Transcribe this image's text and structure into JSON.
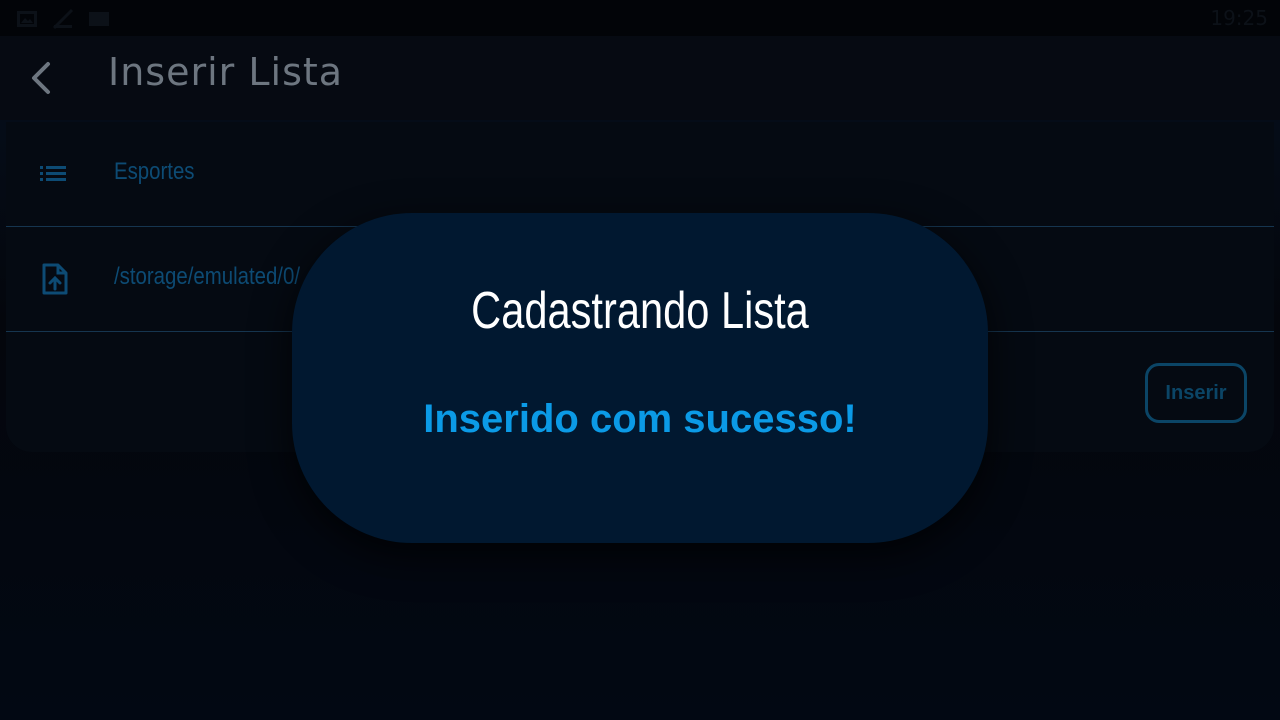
{
  "status_bar": {
    "time": "19:25",
    "icons": [
      "image-icon",
      "signal-icon",
      "card-icon"
    ]
  },
  "header": {
    "back_icon": "chevron-left-icon",
    "title": "Inserir Lista"
  },
  "form": {
    "list_name": {
      "icon": "list-icon",
      "value": "Esportes"
    },
    "file_path": {
      "icon": "file-upload-icon",
      "value": "/storage/emulated/0/"
    },
    "insert_label": "Inserir"
  },
  "dialog": {
    "title": "Cadastrando Lista",
    "message": "Inserido com sucesso!"
  },
  "colors": {
    "dialog_bg": "#011830",
    "accent": "#0b9ae6",
    "field_text": "#0d4b74"
  }
}
